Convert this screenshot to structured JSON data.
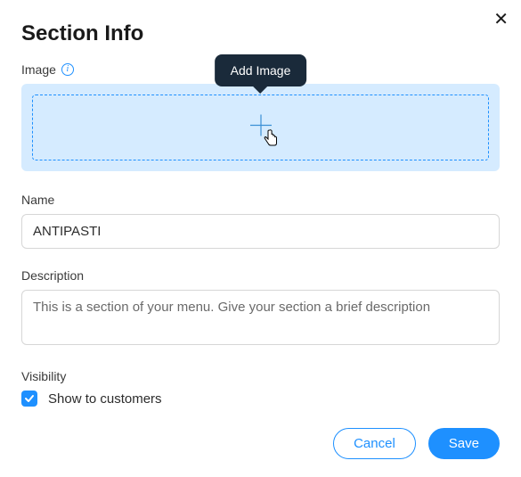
{
  "dialog": {
    "title": "Section Info",
    "close_glyph": "✕"
  },
  "image": {
    "label": "Image",
    "info_glyph": "i",
    "tooltip": "Add Image"
  },
  "name": {
    "label": "Name",
    "value": "ANTIPASTI"
  },
  "description": {
    "label": "Description",
    "value": "",
    "placeholder": "This is a section of your menu. Give your section a brief description"
  },
  "visibility": {
    "label": "Visibility",
    "checkbox": {
      "checked": true
    },
    "checkbox_label": "Show to customers"
  },
  "buttons": {
    "cancel": "Cancel",
    "save": "Save"
  }
}
